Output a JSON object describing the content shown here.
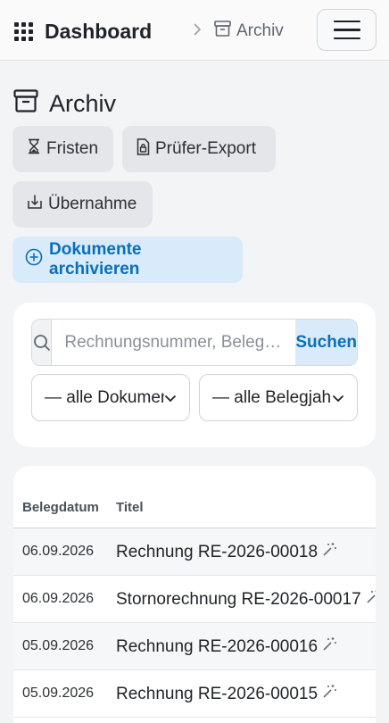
{
  "header": {
    "brand": "Dashboard",
    "breadcrumb": "Archiv"
  },
  "page": {
    "title": "Archiv"
  },
  "actions": {
    "fristen": "Fristen",
    "pruefer_export": "Prüfer-Export",
    "uebernahme": "Übernahme",
    "archive_docs": "Dokumente archivieren"
  },
  "search": {
    "placeholder": "Rechnungsnummer, Beleg…",
    "button": "Suchen",
    "doc_filter": "— alle Dokumente",
    "year_filter": "— alle Belegjahre"
  },
  "table": {
    "columns": [
      "Belegdatum",
      "Titel"
    ],
    "rows": [
      {
        "date": "06.09.2026",
        "title": "Rechnung RE-2026-00018"
      },
      {
        "date": "06.09.2026",
        "title": "Stornorechnung RE-2026-00017"
      },
      {
        "date": "05.09.2026",
        "title": "Rechnung RE-2026-00016"
      },
      {
        "date": "05.09.2026",
        "title": "Rechnung RE-2026-00015"
      }
    ]
  },
  "colors": {
    "accent": "#0a6fb8",
    "accent_bg": "#d9ebfa",
    "secondary_bg": "#e4e6e9"
  },
  "icons": [
    "apps-grid-icon",
    "chevron-right-icon",
    "archive-box-icon",
    "menu-icon",
    "hourglass-icon",
    "file-lock-icon",
    "download-tray-icon",
    "plus-circle-icon",
    "search-icon",
    "chevron-down-icon",
    "magic-wand-icon"
  ]
}
